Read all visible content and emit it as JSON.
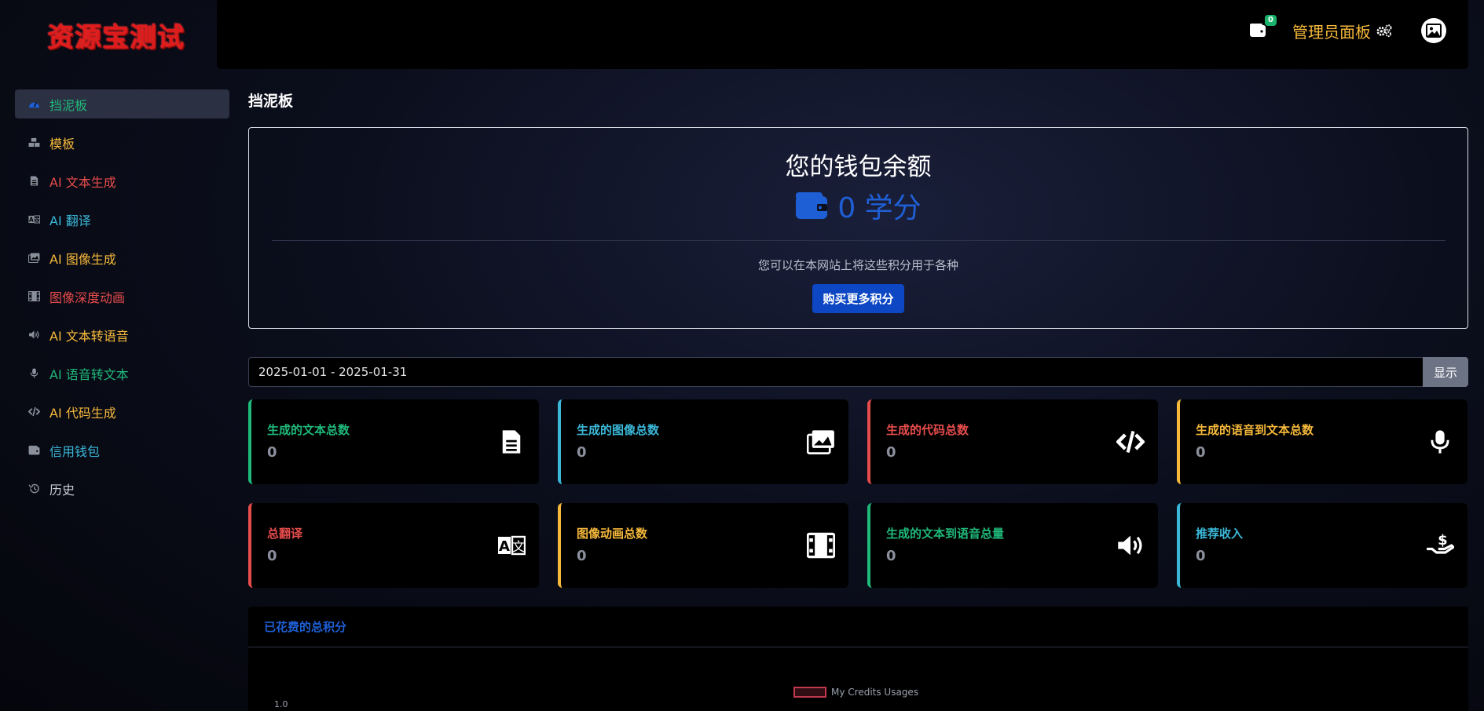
{
  "brand": {
    "title": "资源宝测试"
  },
  "header": {
    "wallet_badge": "0",
    "admin_label": "管理员面板",
    "wallet_icon": "wallet-icon",
    "admin_icon": "gears-icon",
    "avatar_icon": "image-avatar-icon"
  },
  "sidebar": {
    "items": [
      {
        "label": "挡泥板",
        "color": "#1fb97a",
        "icon": "dashboard-icon",
        "active": true
      },
      {
        "label": "模板",
        "color": "#f6b93b",
        "icon": "cubes-icon"
      },
      {
        "label": "AI 文本生成",
        "color": "#e74c4c",
        "icon": "file-text-icon"
      },
      {
        "label": "AI 翻译",
        "color": "#3bb8d8",
        "icon": "language-icon"
      },
      {
        "label": "AI 图像生成",
        "color": "#f6b93b",
        "icon": "images-icon"
      },
      {
        "label": "图像深度动画",
        "color": "#e74c4c",
        "icon": "film-icon"
      },
      {
        "label": "AI 文本转语音",
        "color": "#f6b93b",
        "icon": "volume-icon"
      },
      {
        "label": "AI 语音转文本",
        "color": "#1fb97a",
        "icon": "microphone-icon"
      },
      {
        "label": "AI 代码生成",
        "color": "#f6b93b",
        "icon": "code-icon"
      },
      {
        "label": "信用钱包",
        "color": "#3bb8d8",
        "icon": "wallet-icon"
      },
      {
        "label": "历史",
        "color": "#c9ccd4",
        "icon": "history-icon"
      }
    ]
  },
  "main": {
    "page_title": "挡泥板",
    "balance": {
      "title": "您的钱包余额",
      "value": "0 学分",
      "note": "您可以在本网站上将这些积分用于各种",
      "buy_label": "购买更多积分"
    },
    "date_range": {
      "value": "2025-01-01 - 2025-01-31",
      "show_label": "显示"
    },
    "stats": [
      {
        "label": "生成的文本总数",
        "value": "0",
        "color": "#1fb97a",
        "icon": "file-text-icon"
      },
      {
        "label": "生成的图像总数",
        "value": "0",
        "color": "#3bb8d8",
        "icon": "images-icon"
      },
      {
        "label": "生成的代码总数",
        "value": "0",
        "color": "#e74c4c",
        "icon": "code-icon"
      },
      {
        "label": "生成的语音到文本总数",
        "value": "0",
        "color": "#f6b93b",
        "icon": "microphone-icon"
      },
      {
        "label": "总翻译",
        "value": "0",
        "color": "#e74c4c",
        "icon": "language-icon"
      },
      {
        "label": "图像动画总数",
        "value": "0",
        "color": "#f6b93b",
        "icon": "film-icon"
      },
      {
        "label": "生成的文本到语音总量",
        "value": "0",
        "color": "#1fb97a",
        "icon": "volume-icon"
      },
      {
        "label": "推荐收入",
        "value": "0",
        "color": "#3bb8d8",
        "icon": "hand-dollar-icon"
      }
    ],
    "credits_chart": {
      "title": "已花费的总积分",
      "legend": "My Credits Usages",
      "y_tick": "1.0",
      "legend_color": "#c0394f"
    }
  },
  "colors": {
    "accent_blue": "#1f5fd6",
    "admin_gold": "#f6b93b",
    "button_blue": "#0d47c4"
  }
}
